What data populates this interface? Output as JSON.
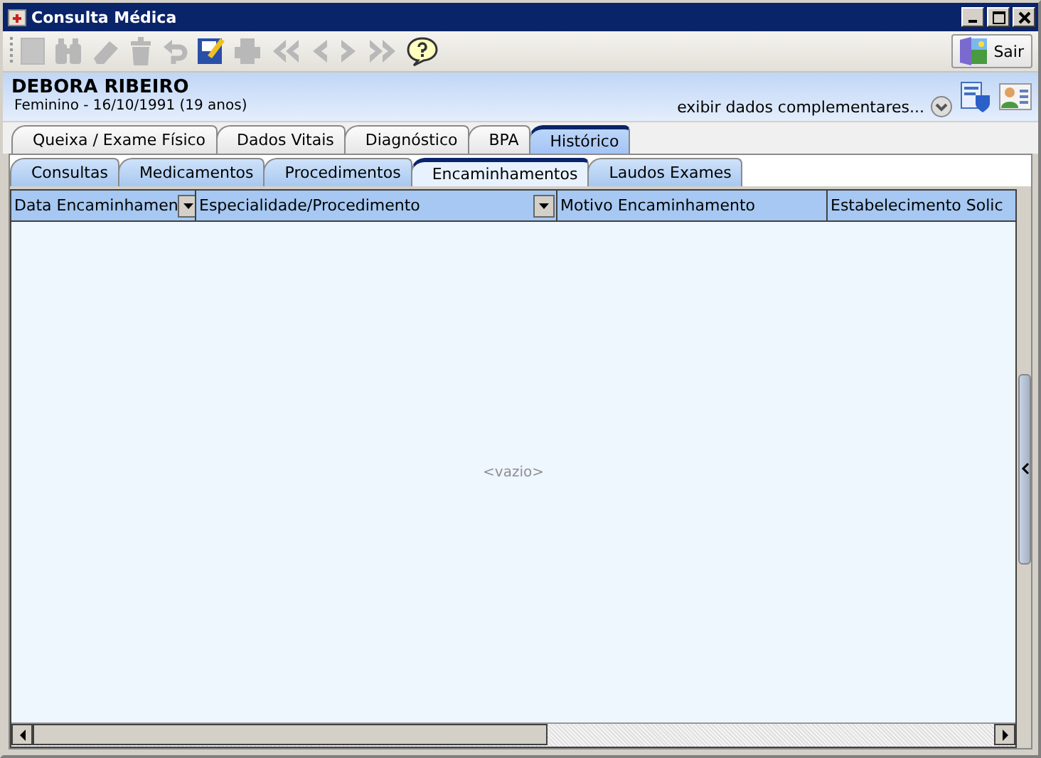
{
  "window": {
    "title": "Consulta Médica"
  },
  "toolbar": [
    {
      "kind": "new",
      "disabled": true
    },
    {
      "kind": "find",
      "disabled": true
    },
    {
      "kind": "erase",
      "disabled": true
    },
    {
      "kind": "delete",
      "disabled": true
    },
    {
      "kind": "undo",
      "disabled": true
    },
    {
      "kind": "edit",
      "disabled": false
    },
    {
      "kind": "print",
      "disabled": true
    },
    {
      "kind": "first",
      "disabled": true
    },
    {
      "kind": "prev",
      "disabled": true
    },
    {
      "kind": "next",
      "disabled": true
    },
    {
      "kind": "last",
      "disabled": true
    },
    {
      "kind": "help",
      "disabled": false
    }
  ],
  "exit_button": {
    "label": "Sair"
  },
  "patient": {
    "name": "DEBORA RIBEIRO",
    "details": "Feminino - 16/10/1991 (19 anos)",
    "more_link": "exibir dados complementares..."
  },
  "tabs": [
    {
      "label": "Queixa / Exame Físico",
      "selected": false
    },
    {
      "label": "Dados Vitais",
      "selected": false
    },
    {
      "label": "Diagnóstico",
      "selected": false
    },
    {
      "label": "BPA",
      "selected": false
    },
    {
      "label": "Histórico",
      "selected": true
    }
  ],
  "subtabs": [
    {
      "label": "Consultas",
      "selected": false
    },
    {
      "label": "Medicamentos",
      "selected": false
    },
    {
      "label": "Procedimentos",
      "selected": false
    },
    {
      "label": "Encaminhamentos",
      "selected": true
    },
    {
      "label": "Laudos Exames",
      "selected": false
    }
  ],
  "table": {
    "columns": [
      {
        "label": "Data Encaminhamen",
        "filter": true
      },
      {
        "label": "Especialidade/Procedimento",
        "filter": true
      },
      {
        "label": "Motivo Encaminhamento",
        "filter": false
      },
      {
        "label": "Estabelecimento Solic",
        "filter": false
      }
    ],
    "empty_text": "<vazio>"
  }
}
